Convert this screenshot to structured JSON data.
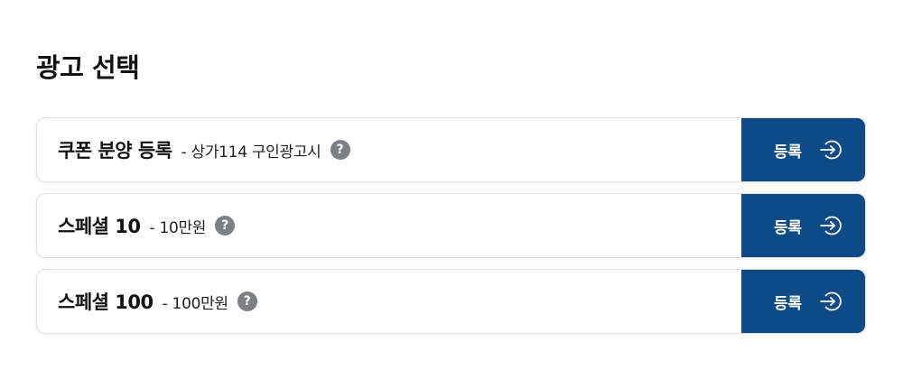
{
  "page": {
    "title": "광고 선택"
  },
  "ads": [
    {
      "name": "쿠폰 분양 등록",
      "description": "- 상가114 구인광고시",
      "help": "?",
      "button_label": "등록"
    },
    {
      "name": "스페셜 10",
      "description": "- 10만원",
      "help": "?",
      "button_label": "등록"
    },
    {
      "name": "스페셜 100",
      "description": "- 100만원",
      "help": "?",
      "button_label": "등록"
    }
  ],
  "icons": {
    "help": "question-circle-icon",
    "register": "login-arrow-icon"
  },
  "colors": {
    "button_bg": "#0e4a86",
    "help_icon_bg": "#7d7f87",
    "card_border": "#e1e1e4"
  }
}
